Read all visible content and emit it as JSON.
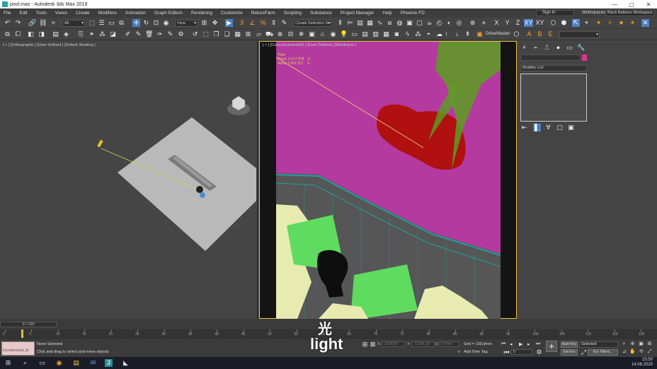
{
  "window": {
    "title": "pool.max - Autodesk 3ds Max 2019",
    "min": "—",
    "max": "▢",
    "close": "✕"
  },
  "menu": {
    "items": [
      "File",
      "Edit",
      "Tools",
      "Views",
      "Create",
      "Modifiers",
      "Animation",
      "Graph Editors",
      "Rendering",
      "Customize",
      "RebusFarm",
      "Scripting",
      "Substance",
      "Project Manager",
      "Help",
      "Phoenix FD"
    ],
    "sign_in": "Sign In",
    "workspaces_label": "Workspaces:",
    "workspace_value": "Black Balance Workspace"
  },
  "toolbar": {
    "filter_value": "All",
    "ref_coord_value": "View",
    "selection_set_value": "Create Selection Se",
    "driver_master": "DriverMaster",
    "axes": [
      "X",
      "Y",
      "Z",
      "XY",
      "XY"
    ]
  },
  "viewports": {
    "left_label": "[ + ] [Orthographic ] [User Defined ] [Default Shading ]",
    "right_label": "[ + ] [CoronaCamera001 ] [User Defined ] [Wireframe ]"
  },
  "stats": {
    "total_label": "Total",
    "polys_label": "Polys:",
    "polys_value": "4 677 078",
    "polys_sel": "0",
    "verts_label": "Verts:",
    "verts_value": "2 691 971",
    "verts_sel": "0"
  },
  "command_panel": {
    "modifier_list": "Modifier List"
  },
  "timeline": {
    "slider_text": "0 / 120",
    "ticks": [
      "0",
      "5",
      "10",
      "15",
      "20",
      "25",
      "30",
      "35",
      "40",
      "45",
      "50",
      "55",
      "60",
      "65",
      "70",
      "75",
      "80",
      "85",
      "90",
      "95",
      "100",
      "105",
      "110",
      "115",
      "120"
    ]
  },
  "status": {
    "maxscript_title": "",
    "maxscript_sub": "Corvession.b",
    "selection": "None Selected",
    "prompt": "Click and drag to select and move objects",
    "x_label": "X:",
    "x_value": "-5038,56",
    "y_label": "Y:",
    "y_value": "-13248,33",
    "z_label": "Z:",
    "z_value": "0,0mm",
    "grid": "Grid = 100,0mm",
    "add_time_tag": "Add Time Tag",
    "auto_key": "Auto Key",
    "set_key": "Set Key",
    "selected_dd": "Selected",
    "key_filters": "Key Filters...",
    "frame_field": "0"
  },
  "subtitles": {
    "chinese": "光",
    "english": "light"
  },
  "taskbar": {
    "time": "15:50",
    "date": "14.08.2020"
  },
  "colors": {
    "viewport_active_border": "#e9c23a",
    "wire_magenta": "#b43aa0",
    "selection_red": "#b01010",
    "chair_green": "#5fdc5f",
    "plant_cream": "#e8ebb0",
    "rail_teal": "#1fa0a0",
    "tree_green": "#5aa020"
  }
}
